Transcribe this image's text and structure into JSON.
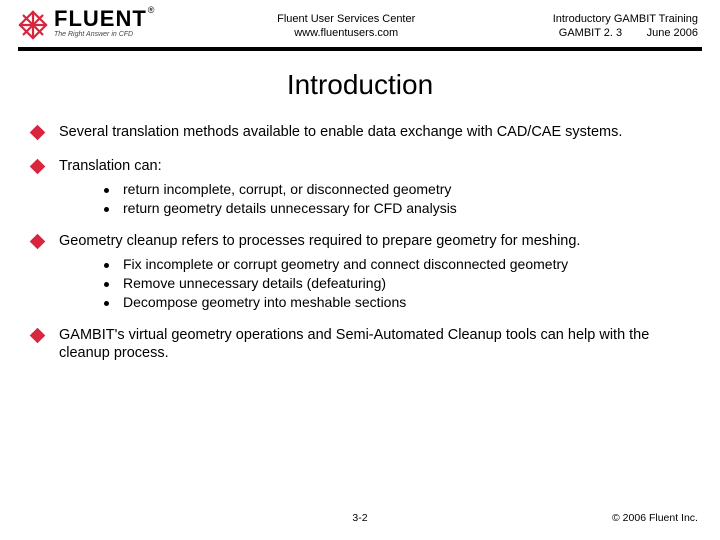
{
  "header": {
    "logo_word": "FLUENT",
    "logo_reg": "®",
    "logo_tagline": "The Right Answer in CFD",
    "center_line1": "Fluent User Services Center",
    "center_line2": "www.fluentusers.com",
    "right_line1": "Introductory GAMBIT Training",
    "right_line2_left": "GAMBIT 2. 3",
    "right_line2_right": "June 2006"
  },
  "title": "Introduction",
  "bullets": [
    {
      "text": "Several translation methods available to enable data exchange with CAD/CAE systems.",
      "subs": []
    },
    {
      "text": "Translation can:",
      "subs": [
        "return incomplete, corrupt, or disconnected geometry",
        "return geometry details unnecessary for CFD analysis"
      ]
    },
    {
      "text": "Geometry cleanup refers to processes required to prepare geometry for meshing.",
      "subs": [
        "Fix incomplete or corrupt geometry and connect disconnected geometry",
        "Remove unnecessary details (defeaturing)",
        "Decompose geometry into meshable sections"
      ]
    },
    {
      "text": "GAMBIT's virtual geometry operations and Semi-Automated Cleanup tools can help with the cleanup process.",
      "subs": []
    }
  ],
  "footer": {
    "page": "3-2",
    "copyright": "© 2006 Fluent Inc."
  }
}
